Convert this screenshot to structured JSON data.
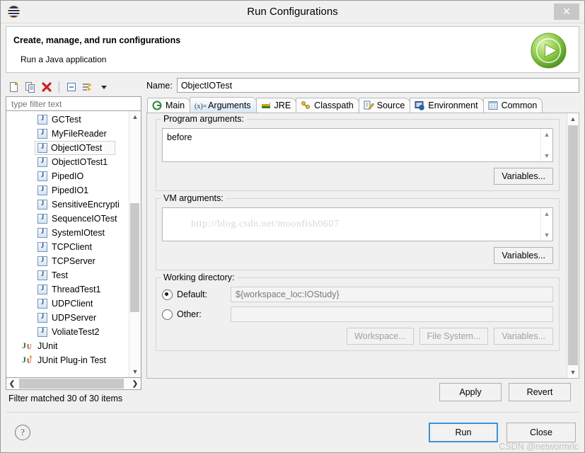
{
  "window": {
    "title": "Run Configurations",
    "app_icon": "eclipse-icon",
    "close_label": "✕"
  },
  "header": {
    "title": "Create, manage, and run configurations",
    "subtitle": "Run a Java application",
    "badge_icon": "run-green-play-icon"
  },
  "left_pane": {
    "toolbar": [
      {
        "name": "new-launch-configuration-icon",
        "label": "New"
      },
      {
        "name": "duplicate-icon",
        "label": "Duplicate"
      },
      {
        "name": "delete-icon",
        "label": "Delete"
      },
      {
        "name": "collapse-all-icon",
        "label": "Collapse All"
      },
      {
        "name": "filter-icon",
        "label": "Filter"
      },
      {
        "name": "chevron-down-icon",
        "label": "Menu"
      }
    ],
    "filter_placeholder": "type filter text",
    "filter_value": "",
    "tree": [
      {
        "label": "GCTest",
        "icon": "java-config-icon",
        "level": 1,
        "selected": false
      },
      {
        "label": "MyFileReader",
        "icon": "java-config-icon",
        "level": 1,
        "selected": false
      },
      {
        "label": "ObjectIOTest",
        "icon": "java-config-icon",
        "level": 1,
        "selected": true
      },
      {
        "label": "ObjectIOTest1",
        "icon": "java-config-icon",
        "level": 1,
        "selected": false
      },
      {
        "label": "PipedIO",
        "icon": "java-config-icon",
        "level": 1,
        "selected": false
      },
      {
        "label": "PipedIO1",
        "icon": "java-config-icon",
        "level": 1,
        "selected": false
      },
      {
        "label": "SensitiveEncrypti",
        "icon": "java-config-icon",
        "level": 1,
        "selected": false
      },
      {
        "label": "SequenceIOTest",
        "icon": "java-config-icon",
        "level": 1,
        "selected": false
      },
      {
        "label": "SystemIOtest",
        "icon": "java-config-icon",
        "level": 1,
        "selected": false
      },
      {
        "label": "TCPClient",
        "icon": "java-config-icon",
        "level": 1,
        "selected": false
      },
      {
        "label": "TCPServer",
        "icon": "java-config-icon",
        "level": 1,
        "selected": false
      },
      {
        "label": "Test",
        "icon": "java-config-icon",
        "level": 1,
        "selected": false
      },
      {
        "label": "ThreadTest1",
        "icon": "java-config-icon",
        "level": 1,
        "selected": false
      },
      {
        "label": "UDPClient",
        "icon": "java-config-icon",
        "level": 1,
        "selected": false
      },
      {
        "label": "UDPServer",
        "icon": "java-config-icon",
        "level": 1,
        "selected": false
      },
      {
        "label": "VoliateTest2",
        "icon": "java-config-icon",
        "level": 1,
        "selected": false
      },
      {
        "label": "JUnit",
        "icon": "junit-icon",
        "level": 0,
        "selected": false
      },
      {
        "label": "JUnit Plug-in Test",
        "icon": "junit-plugin-icon",
        "level": 0,
        "selected": false
      }
    ],
    "status": "Filter matched 30 of 30 items"
  },
  "right_pane": {
    "name_label": "Name:",
    "name_value": "ObjectIOTest",
    "tabs": [
      {
        "label": "Main",
        "icon": "main-icon",
        "active": false
      },
      {
        "label": "Arguments",
        "icon": "arguments-icon",
        "active": true
      },
      {
        "label": "JRE",
        "icon": "jre-icon",
        "active": false
      },
      {
        "label": "Classpath",
        "icon": "classpath-icon",
        "active": false
      },
      {
        "label": "Source",
        "icon": "source-icon",
        "active": false
      },
      {
        "label": "Environment",
        "icon": "environment-icon",
        "active": false
      },
      {
        "label": "Common",
        "icon": "common-icon",
        "active": false
      }
    ],
    "program_arguments": {
      "group_label": "Program arguments:",
      "value": "before",
      "variables_button": "Variables..."
    },
    "vm_arguments": {
      "group_label": "VM arguments:",
      "value": "http://blog.csdn.net/moonfish0607",
      "variables_button": "Variables..."
    },
    "working_directory": {
      "group_label": "Working directory:",
      "default_label": "Default:",
      "default_value": "${workspace_loc:IOStudy}",
      "default_selected": true,
      "other_label": "Other:",
      "other_value": "",
      "other_selected": false,
      "workspace_button": "Workspace...",
      "file_system_button": "File System...",
      "variables_button": "Variables..."
    }
  },
  "footer": {
    "apply_label": "Apply",
    "revert_label": "Revert",
    "help_icon": "help-question-icon",
    "run_label": "Run",
    "close_label": "Close",
    "watermark": "CSDN @networmrlc"
  },
  "colors": {
    "accent": "#3c93d6",
    "dialog_bg": "#f0f0f0",
    "active_tab": "#d7e7f6",
    "delete_red": "#cc2222",
    "run_green": "#76c043"
  }
}
